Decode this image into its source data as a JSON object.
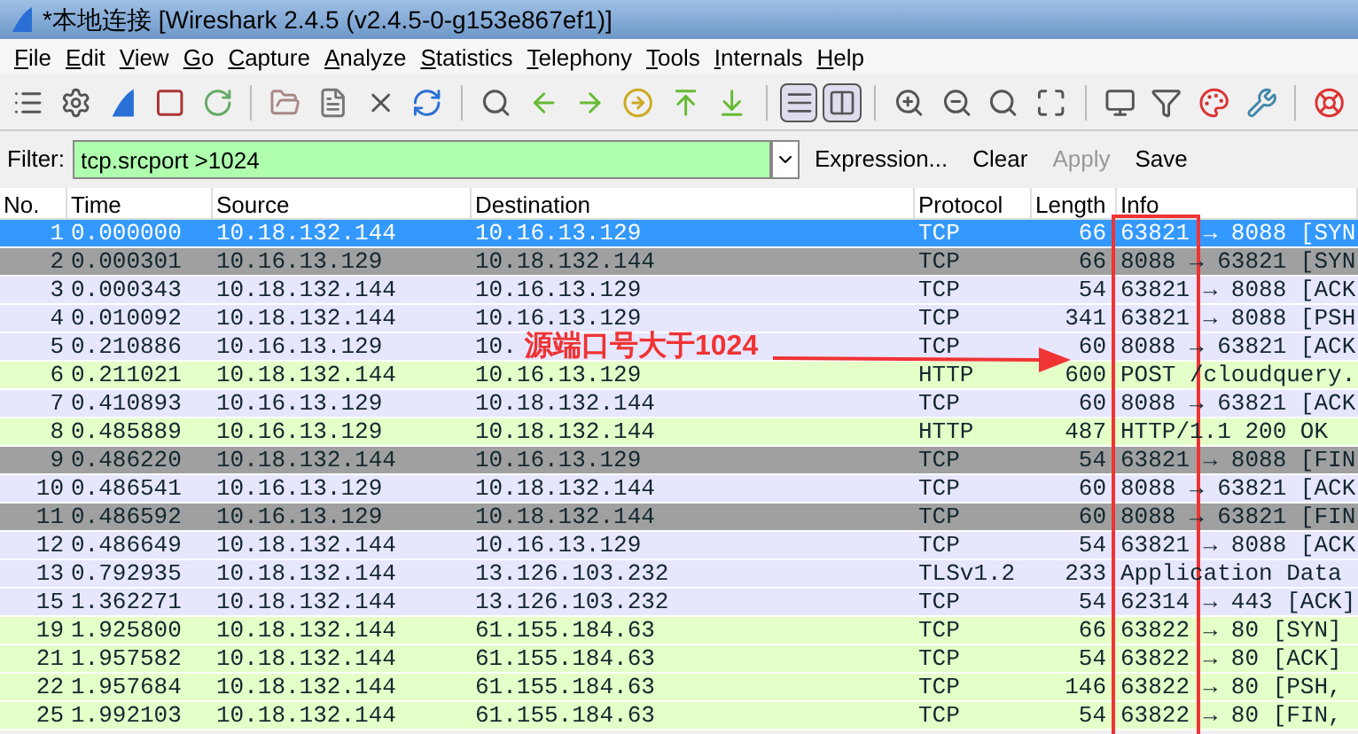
{
  "window": {
    "title": "*本地连接 [Wireshark 2.4.5 (v2.4.5-0-g153e867ef1)]"
  },
  "menu": [
    "File",
    "Edit",
    "View",
    "Go",
    "Capture",
    "Analyze",
    "Statistics",
    "Telephony",
    "Tools",
    "Internals",
    "Help"
  ],
  "filter": {
    "label": "Filter:",
    "value": "tcp.srcport >1024",
    "buttons": [
      {
        "label": "Expression...",
        "disabled": false
      },
      {
        "label": "Clear",
        "disabled": false
      },
      {
        "label": "Apply",
        "disabled": true
      },
      {
        "label": "Save",
        "disabled": false
      }
    ]
  },
  "table": {
    "columns": [
      "No.",
      "Time",
      "Source",
      "Destination",
      "Protocol",
      "Length",
      "Info"
    ],
    "rows": [
      {
        "cells": [
          "1",
          "0.000000",
          "10.18.132.144",
          "10.16.13.129",
          "TCP",
          "66",
          "63821 → 8088 [SYN"
        ],
        "selected": true,
        "color": "#3399ff"
      },
      {
        "cells": [
          "2",
          "0.000301",
          "10.16.13.129",
          "10.18.132.144",
          "TCP",
          "66",
          "8088 → 63821 [SYN"
        ],
        "selected": false,
        "color": "#a0a0a0"
      },
      {
        "cells": [
          "3",
          "0.000343",
          "10.18.132.144",
          "10.16.13.129",
          "TCP",
          "54",
          "63821 → 8088 [ACK"
        ],
        "selected": false,
        "color": "#e7e6ff"
      },
      {
        "cells": [
          "4",
          "0.010092",
          "10.18.132.144",
          "10.16.13.129",
          "TCP",
          "341",
          "63821 → 8088 [PSH"
        ],
        "selected": false,
        "color": "#e7e6ff"
      },
      {
        "cells": [
          "5",
          "0.210886",
          "10.16.13.129",
          "10.",
          "TCP",
          "60",
          "8088 → 63821 [ACK"
        ],
        "selected": false,
        "color": "#e7e6ff"
      },
      {
        "cells": [
          "6",
          "0.211021",
          "10.18.132.144",
          "10.16.13.129",
          "HTTP",
          "600",
          "POST /cloudquery."
        ],
        "selected": false,
        "color": "#e4ffc7"
      },
      {
        "cells": [
          "7",
          "0.410893",
          "10.16.13.129",
          "10.18.132.144",
          "TCP",
          "60",
          "8088 → 63821 [ACK"
        ],
        "selected": false,
        "color": "#e7e6ff"
      },
      {
        "cells": [
          "8",
          "0.485889",
          "10.16.13.129",
          "10.18.132.144",
          "HTTP",
          "487",
          "HTTP/1.1 200 OK"
        ],
        "selected": false,
        "color": "#e4ffc7"
      },
      {
        "cells": [
          "9",
          "0.486220",
          "10.18.132.144",
          "10.16.13.129",
          "TCP",
          "54",
          "63821 → 8088 [FIN"
        ],
        "selected": false,
        "color": "#a0a0a0"
      },
      {
        "cells": [
          "10",
          "0.486541",
          "10.16.13.129",
          "10.18.132.144",
          "TCP",
          "60",
          "8088 → 63821 [ACK"
        ],
        "selected": false,
        "color": "#e7e6ff"
      },
      {
        "cells": [
          "11",
          "0.486592",
          "10.16.13.129",
          "10.18.132.144",
          "TCP",
          "60",
          "8088 → 63821 [FIN"
        ],
        "selected": false,
        "color": "#a0a0a0"
      },
      {
        "cells": [
          "12",
          "0.486649",
          "10.18.132.144",
          "10.16.13.129",
          "TCP",
          "54",
          "63821 → 8088 [ACK"
        ],
        "selected": false,
        "color": "#e7e6ff"
      },
      {
        "cells": [
          "13",
          "0.792935",
          "10.18.132.144",
          "13.126.103.232",
          "TLSv1.2",
          "233",
          "Application Data"
        ],
        "selected": false,
        "color": "#e7e6ff"
      },
      {
        "cells": [
          "15",
          "1.362271",
          "10.18.132.144",
          "13.126.103.232",
          "TCP",
          "54",
          "62314 → 443 [ACK]"
        ],
        "selected": false,
        "color": "#e7e6ff"
      },
      {
        "cells": [
          "19",
          "1.925800",
          "10.18.132.144",
          "61.155.184.63",
          "TCP",
          "66",
          "63822 → 80 [SYN]"
        ],
        "selected": false,
        "color": "#e4ffc7"
      },
      {
        "cells": [
          "21",
          "1.957582",
          "10.18.132.144",
          "61.155.184.63",
          "TCP",
          "54",
          "63822 → 80 [ACK]"
        ],
        "selected": false,
        "color": "#e4ffc7"
      },
      {
        "cells": [
          "22",
          "1.957684",
          "10.18.132.144",
          "61.155.184.63",
          "TCP",
          "146",
          "63822 → 80 [PSH,"
        ],
        "selected": false,
        "color": "#e4ffc7"
      },
      {
        "cells": [
          "25",
          "1.992103",
          "10.18.132.144",
          "61.155.184.63",
          "TCP",
          "54",
          "63822 → 80 [FIN,"
        ],
        "selected": false,
        "color": "#e4ffc7"
      }
    ]
  },
  "annotation": {
    "text": "源端口号大于1024"
  }
}
